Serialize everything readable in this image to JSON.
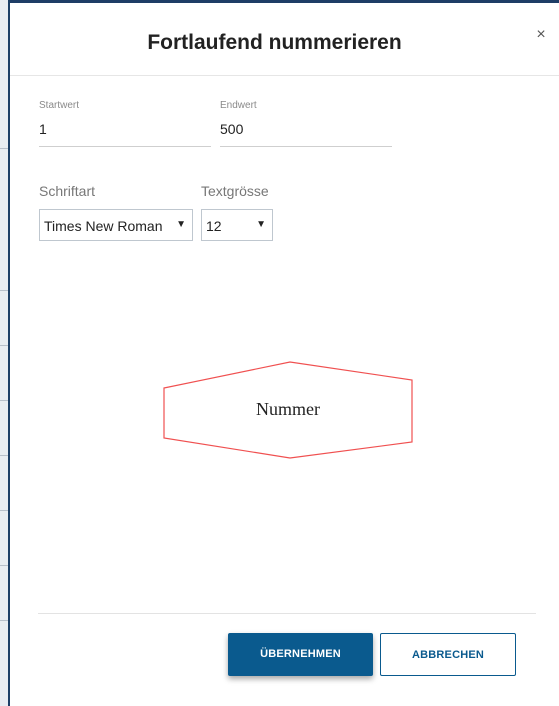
{
  "dialog": {
    "title": "Fortlaufend nummerieren",
    "close_glyph": "×"
  },
  "fields": {
    "start": {
      "label": "Startwert",
      "value": "1"
    },
    "end": {
      "label": "Endwert",
      "value": "500"
    }
  },
  "font": {
    "label": "Schriftart",
    "selected": "Times New Roman"
  },
  "size": {
    "label": "Textgrösse",
    "selected": "12"
  },
  "select_arrow_glyph": "▼",
  "preview": {
    "text": "Nummer",
    "shape": "hexagon",
    "outline_color": "#f05050"
  },
  "buttons": {
    "apply": "ÜBERNEHMEN",
    "cancel": "ABBRECHEN"
  },
  "colors": {
    "primary": "#0a5a8e",
    "header_accent": "#1e3d66"
  }
}
